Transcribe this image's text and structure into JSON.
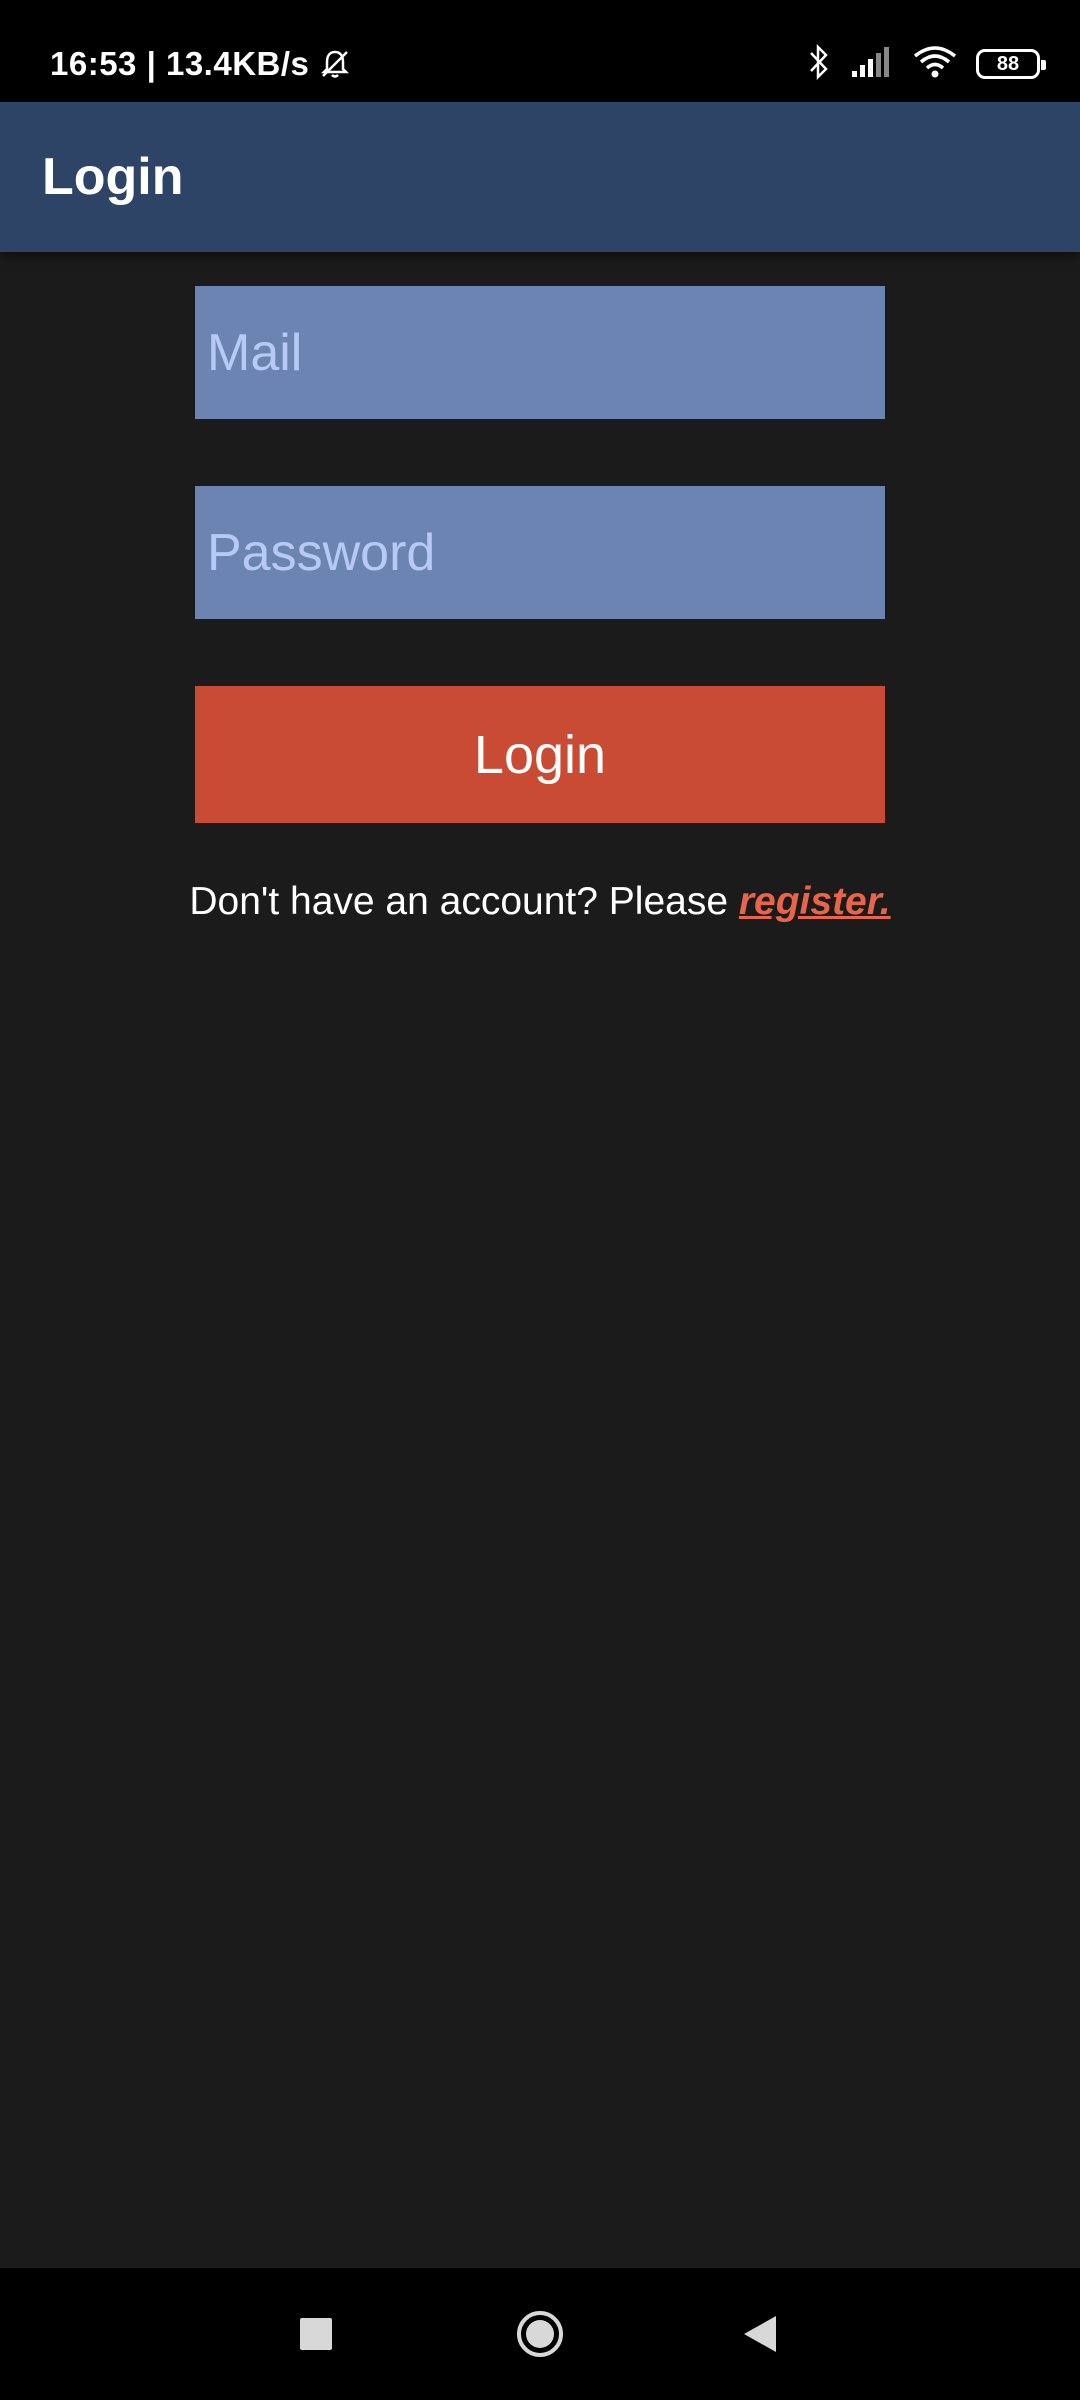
{
  "status_bar": {
    "time_speed": "16:53 | 13.4KB/s",
    "battery": "88",
    "icons": [
      "mute-icon",
      "bluetooth-icon",
      "signal-icon",
      "wifi-icon",
      "battery-icon"
    ]
  },
  "app_bar": {
    "title": "Login"
  },
  "form": {
    "mail_placeholder": "Mail",
    "password_placeholder": "Password",
    "login_label": "Login",
    "register_prompt": "Don't have an account? Please ",
    "register_link": "register."
  },
  "nav_bar": {
    "icons": [
      "recents-icon",
      "home-icon",
      "back-icon"
    ]
  },
  "colors": {
    "background": "#1b1b1b",
    "app_bar": "#2e4466",
    "field": "#6c84b2",
    "placeholder": "#b6caf5",
    "button": "#c94b33",
    "link": "#e8654a"
  }
}
